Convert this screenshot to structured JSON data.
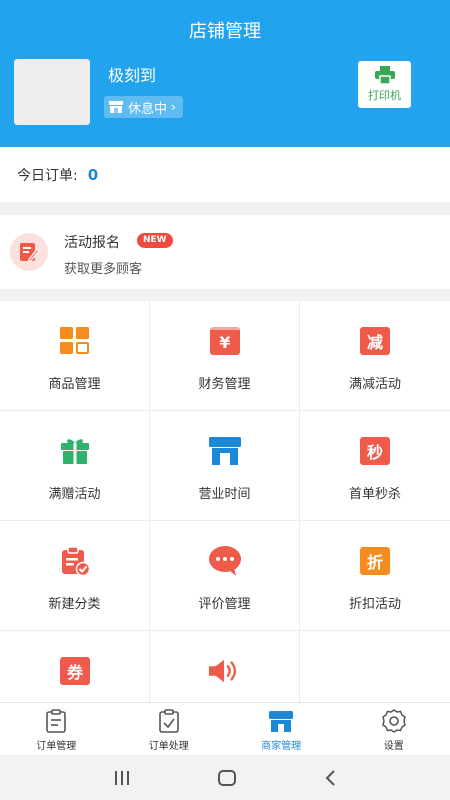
{
  "header": {
    "title": "店铺管理",
    "shop_name": "极刻到",
    "status": "休息中",
    "status_chevron": "›",
    "print_label": "打印机"
  },
  "orders_today": {
    "label": "今日订单:",
    "count": "0"
  },
  "activity": {
    "title": "活动报名",
    "badge": "NEW",
    "subtitle": "获取更多顾客"
  },
  "grid": {
    "items": [
      {
        "label": "商品管理",
        "icon": "goods-grid-icon"
      },
      {
        "label": "财务管理",
        "icon": "finance-icon",
        "glyph": "¥"
      },
      {
        "label": "满减活动",
        "icon": "discount-reduce-icon",
        "glyph": "减"
      },
      {
        "label": "满赠活动",
        "icon": "gift-icon"
      },
      {
        "label": "营业时间",
        "icon": "storefront-icon"
      },
      {
        "label": "首单秒杀",
        "icon": "flash-sale-icon",
        "glyph": "秒"
      },
      {
        "label": "新建分类",
        "icon": "clipboard-check-icon"
      },
      {
        "label": "评价管理",
        "icon": "chat-bubble-icon"
      },
      {
        "label": "折扣活动",
        "icon": "discount-icon",
        "glyph": "折"
      },
      {
        "label": "",
        "icon": "coupon-icon",
        "glyph": "券"
      },
      {
        "label": "",
        "icon": "speaker-icon"
      }
    ]
  },
  "tabs": [
    {
      "label": "订单管理",
      "icon": "order-list-icon"
    },
    {
      "label": "订单处理",
      "icon": "order-check-icon"
    },
    {
      "label": "商家管理",
      "icon": "store-icon",
      "active": true
    },
    {
      "label": "设置",
      "icon": "settings-gear-icon"
    }
  ],
  "colors": {
    "header_bg": "#22a3ee",
    "orange": "#f68b1f",
    "red": "#ef5b4b",
    "green": "#2fb36a",
    "blue": "#1e88d8"
  }
}
